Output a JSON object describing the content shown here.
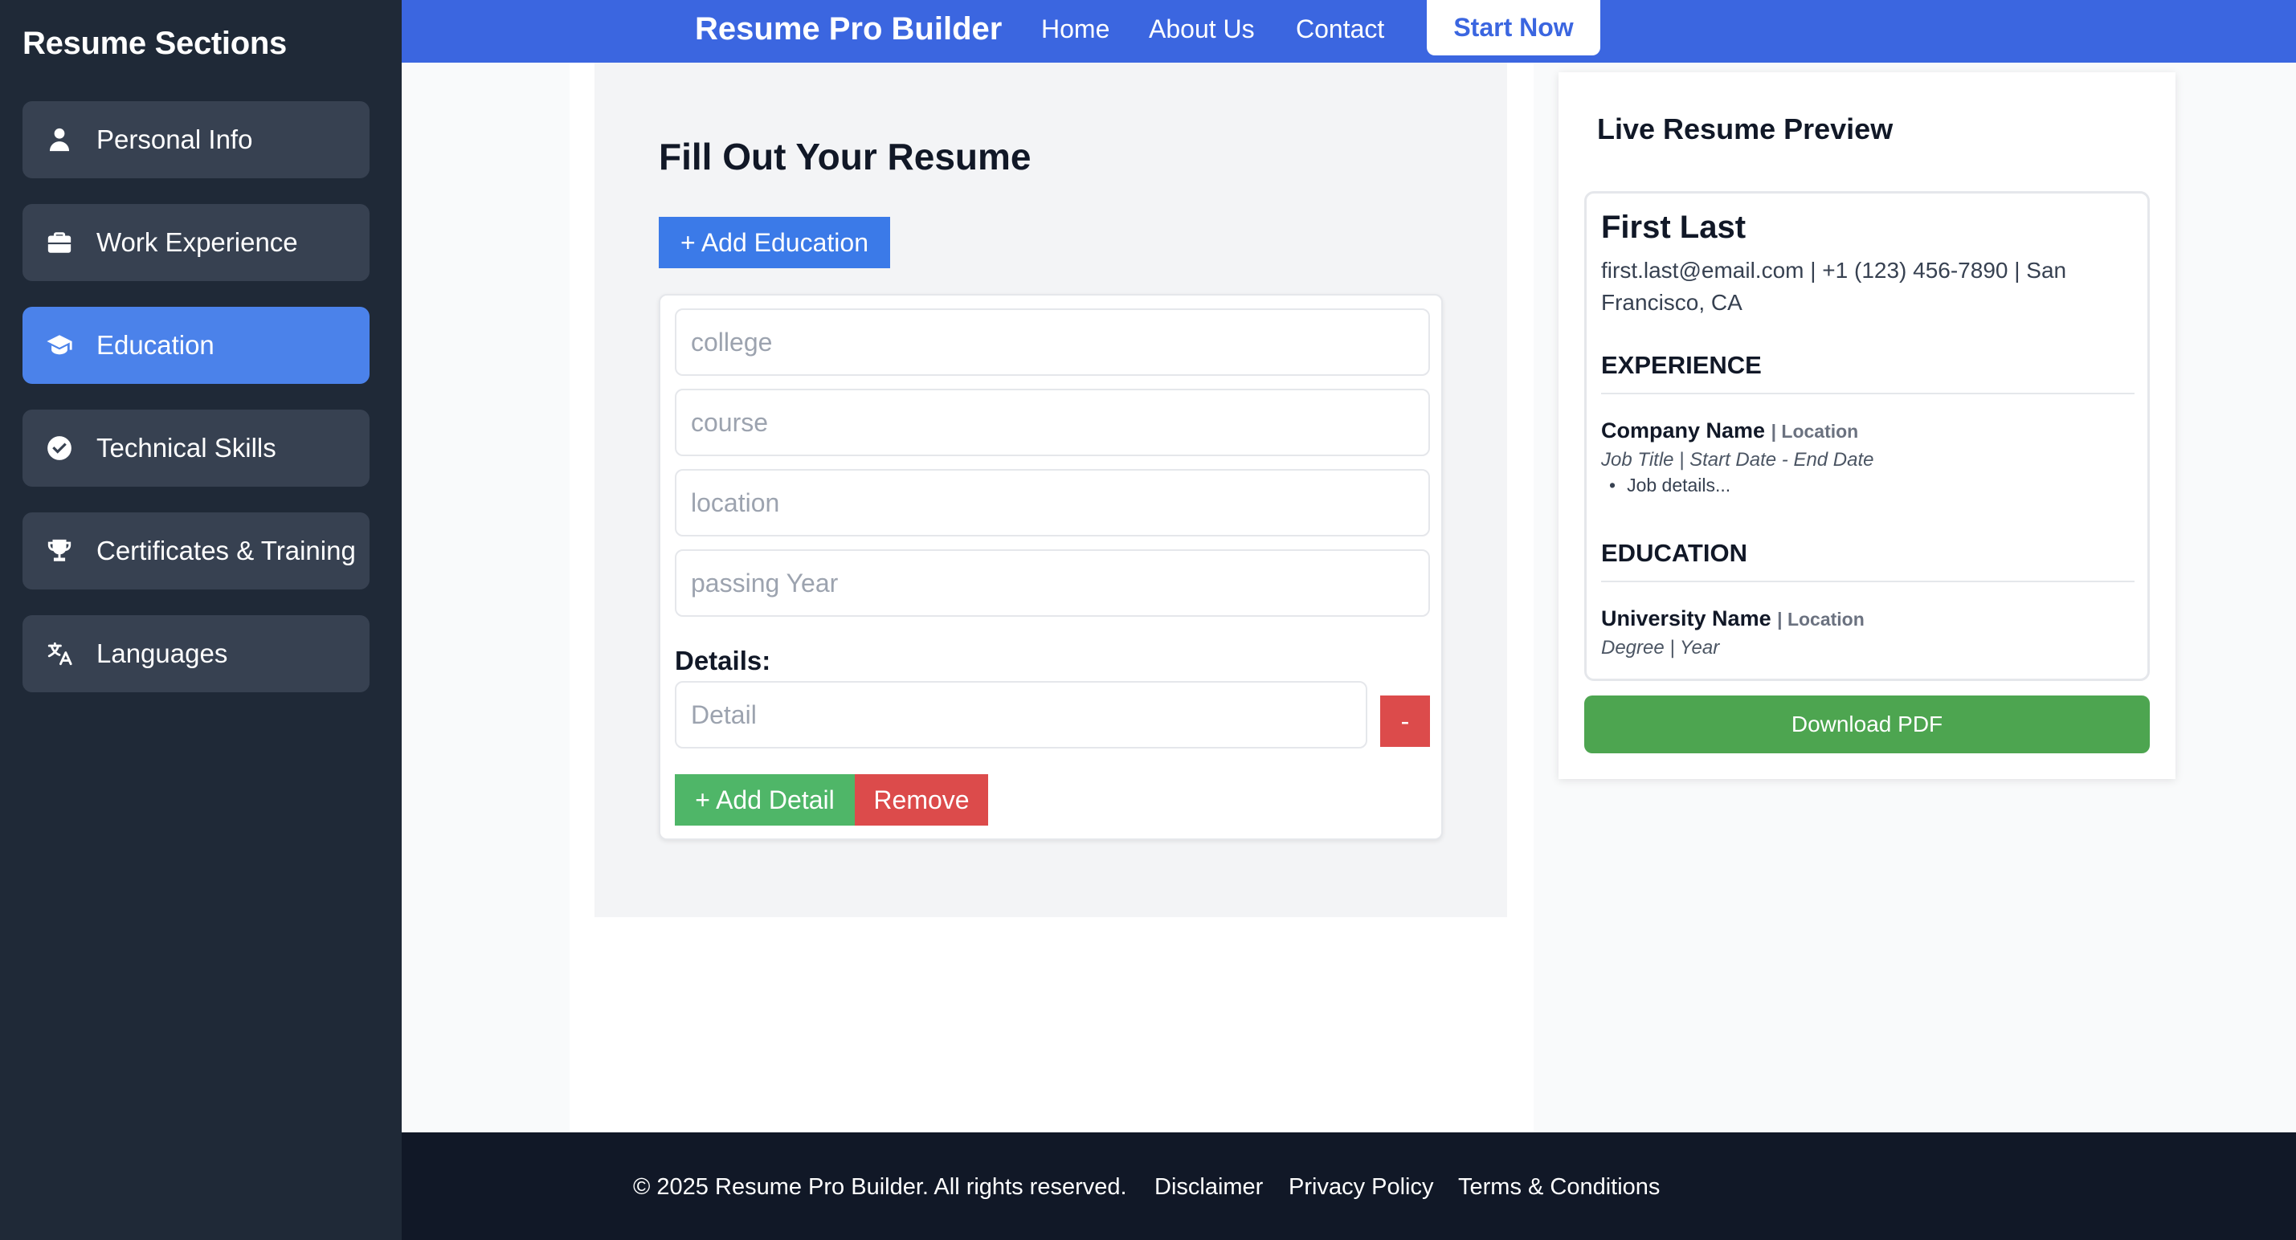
{
  "sidebar": {
    "title": "Resume Sections",
    "items": [
      {
        "label": "Personal Info",
        "icon": "person-icon",
        "active": false
      },
      {
        "label": "Work Experience",
        "icon": "briefcase-icon",
        "active": false
      },
      {
        "label": "Education",
        "icon": "graduation-cap-icon",
        "active": true
      },
      {
        "label": "Technical Skills",
        "icon": "check-circle-icon",
        "active": false
      },
      {
        "label": "Certificates & Training",
        "icon": "trophy-icon",
        "active": false
      },
      {
        "label": "Languages",
        "icon": "translate-icon",
        "active": false
      }
    ]
  },
  "nav": {
    "brand": "Resume Pro Builder",
    "links": [
      "Home",
      "About Us",
      "Contact"
    ],
    "cta": "Start Now"
  },
  "form": {
    "heading": "Fill Out Your Resume",
    "add_education": "+ Add Education",
    "fields": {
      "college": {
        "placeholder": "college",
        "value": ""
      },
      "course": {
        "placeholder": "course",
        "value": ""
      },
      "location": {
        "placeholder": "location",
        "value": ""
      },
      "passing_year": {
        "placeholder": "passing Year",
        "value": ""
      }
    },
    "details_label": "Details:",
    "detail_placeholder": "Detail",
    "minus_label": "-",
    "add_detail": "+ Add Detail",
    "remove": "Remove"
  },
  "preview": {
    "title": "Live Resume Preview",
    "name": "First Last",
    "contact": "first.last@email.com | +1 (123) 456-7890 | San Francisco, CA",
    "experience": {
      "heading": "EXPERIENCE",
      "company": "Company Name",
      "location": "| Location",
      "subtitle": "Job Title | Start Date - End Date",
      "bullet": "Job details..."
    },
    "education": {
      "heading": "EDUCATION",
      "school": "University Name",
      "location": "| Location",
      "subtitle": "Degree | Year"
    },
    "download": "Download PDF"
  },
  "footer": {
    "copyright": "© 2025 Resume Pro Builder. All rights reserved.",
    "links": [
      "Disclaimer",
      "Privacy Policy",
      "Terms & Conditions"
    ]
  },
  "colors": {
    "sidebar_bg": "#1f2937",
    "nav_bg": "#3b66e0",
    "active_item": "#4b82ea",
    "green": "#4fb668",
    "red": "#dc4b4b",
    "footer_bg": "#111827"
  }
}
